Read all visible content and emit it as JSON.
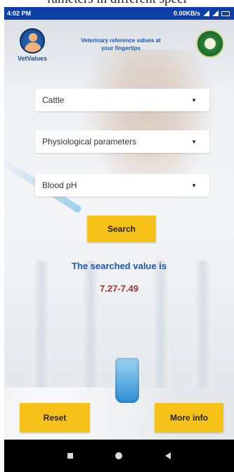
{
  "top_caption": "rameters in different speci",
  "status_bar": {
    "time": "4:02 PM",
    "network_text": "0.00KB/s"
  },
  "header": {
    "app_logo_text": "VetValues",
    "tagline_line1": "Veterinary reference values at",
    "tagline_line2": "your fingertips"
  },
  "dropdowns": {
    "species": "Cattle",
    "category": "Physiological parameters",
    "parameter": "Blood pH"
  },
  "buttons": {
    "search_label": "Search",
    "reset_label": "Reset",
    "more_info_label": "More info"
  },
  "result": {
    "label": "The searched value is",
    "value": "7.27-7.49"
  },
  "colors": {
    "status_bar_bg": "#0e3fa8",
    "button_yellow": "#f6c21a",
    "result_label_blue": "#1d56b8",
    "result_value_red": "#a9322e"
  },
  "icons": {
    "app_logo": "vet-person-logo-icon",
    "university_logo": "university-seal-icon",
    "dropdown_caret": "caret-down-icon",
    "nav_recent": "square-icon",
    "nav_home": "circle-icon",
    "nav_back": "triangle-back-icon"
  }
}
